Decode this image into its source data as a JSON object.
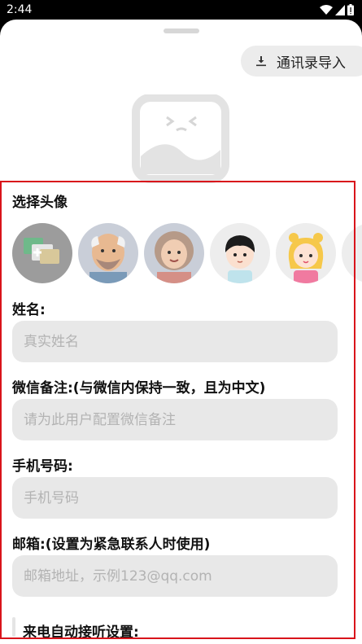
{
  "status": {
    "time": "2:44"
  },
  "header": {
    "import_label": "通讯录导入"
  },
  "avatar_section": {
    "label": "选择头像",
    "avatars": [
      "add-photo-avatar",
      "old-man-avatar",
      "old-woman-avatar",
      "boy-avatar",
      "girl-avatar"
    ]
  },
  "name_field": {
    "label": "姓名:",
    "placeholder": "真实姓名"
  },
  "wechat_field": {
    "label": "微信备注:(与微信内保持一致，且为中文)",
    "placeholder": "请为此用户配置微信备注"
  },
  "phone_field": {
    "label": "手机号码:",
    "placeholder": "手机号码"
  },
  "email_field": {
    "label": "邮箱:(设置为紧急联系人时使用)",
    "placeholder": "邮箱地址，示例123@qq.com"
  },
  "auto_answer": {
    "label": "来电自动接听设置:"
  },
  "colors": {
    "highlight": "#d9141b",
    "field_bg": "#e8e8e8"
  }
}
